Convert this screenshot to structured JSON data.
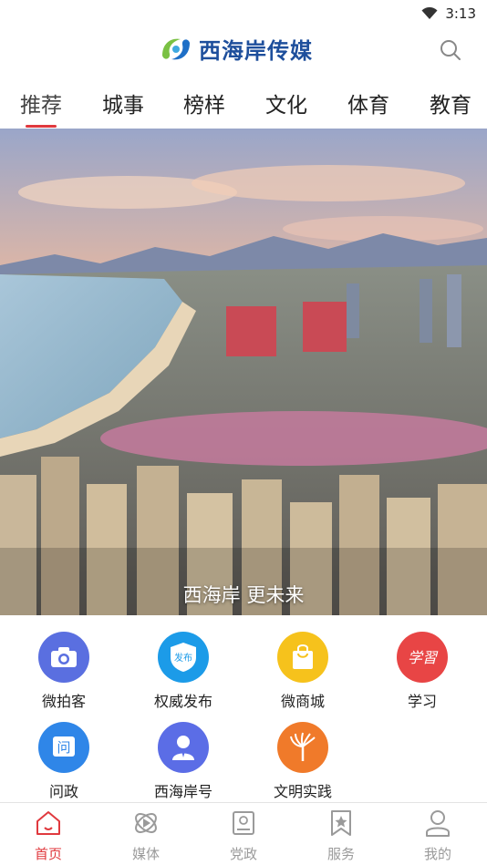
{
  "status_bar": {
    "time": "3:13"
  },
  "header": {
    "app_name": "西海岸传媒"
  },
  "tabs": [
    {
      "label": "推荐",
      "active": true
    },
    {
      "label": "城事",
      "active": false
    },
    {
      "label": "榜样",
      "active": false
    },
    {
      "label": "文化",
      "active": false
    },
    {
      "label": "体育",
      "active": false
    },
    {
      "label": "教育",
      "active": false
    }
  ],
  "banner": {
    "caption": "西海岸 更未来"
  },
  "services": [
    {
      "label": "微拍客",
      "icon": "camera-icon",
      "color": "#5a6fe0"
    },
    {
      "label": "权威发布",
      "icon": "shield-publish-icon",
      "color": "#1c9be8",
      "icon_text": "发布"
    },
    {
      "label": "微商城",
      "icon": "shopping-bag-icon",
      "color": "#f6c21c"
    },
    {
      "label": "学习",
      "icon": "study-icon",
      "color": "#e84545",
      "icon_text": "学習"
    },
    {
      "label": "问政",
      "icon": "inquiry-icon",
      "color": "#2f86e8",
      "icon_text": "问"
    },
    {
      "label": "西海岸号",
      "icon": "user-badge-icon",
      "color": "#5b6de6"
    },
    {
      "label": "文明实践",
      "icon": "civilization-icon",
      "color": "#f07a2a"
    }
  ],
  "bottom_nav": [
    {
      "label": "首页",
      "icon": "home-icon",
      "active": true
    },
    {
      "label": "媒体",
      "icon": "media-icon",
      "active": false
    },
    {
      "label": "党政",
      "icon": "party-book-icon",
      "active": false
    },
    {
      "label": "服务",
      "icon": "service-star-icon",
      "active": false
    },
    {
      "label": "我的",
      "icon": "profile-icon",
      "active": false
    }
  ],
  "colors": {
    "accent": "#e0393e",
    "brand": "#1e4f9c"
  }
}
